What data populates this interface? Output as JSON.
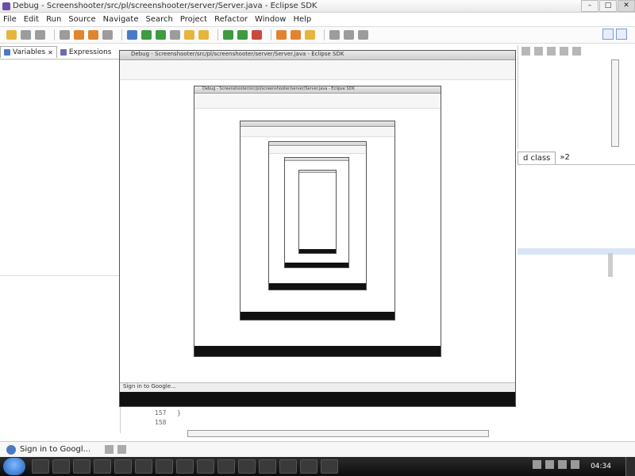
{
  "window": {
    "title": "Debug - Screenshooter/src/pl/screenshooter/server/Server.java - Eclipse SDK",
    "minimize": "–",
    "maximize": "□",
    "close": "✕"
  },
  "menu": [
    "File",
    "Edit",
    "Run",
    "Source",
    "Navigate",
    "Search",
    "Project",
    "Refactor",
    "Window",
    "Help"
  ],
  "left_views": {
    "variables_tab": "Variables",
    "expressions_tab": "Expressions",
    "close_glyph": "✕"
  },
  "outline": {
    "tab_label": "d class",
    "tab2_label": "»2"
  },
  "editor": {
    "lines": [
      {
        "num": "157",
        "code": "}"
      },
      {
        "num": "158",
        "code": ""
      }
    ]
  },
  "nested_capture": {
    "status_text": "Sign in to Google..."
  },
  "status": {
    "signin_text": "Sign in to Googl..."
  },
  "taskbar": {
    "clock": "04:34"
  },
  "icons": {
    "app": "eclipse-icon",
    "start": "windows-start-icon",
    "google": "google-icon"
  }
}
